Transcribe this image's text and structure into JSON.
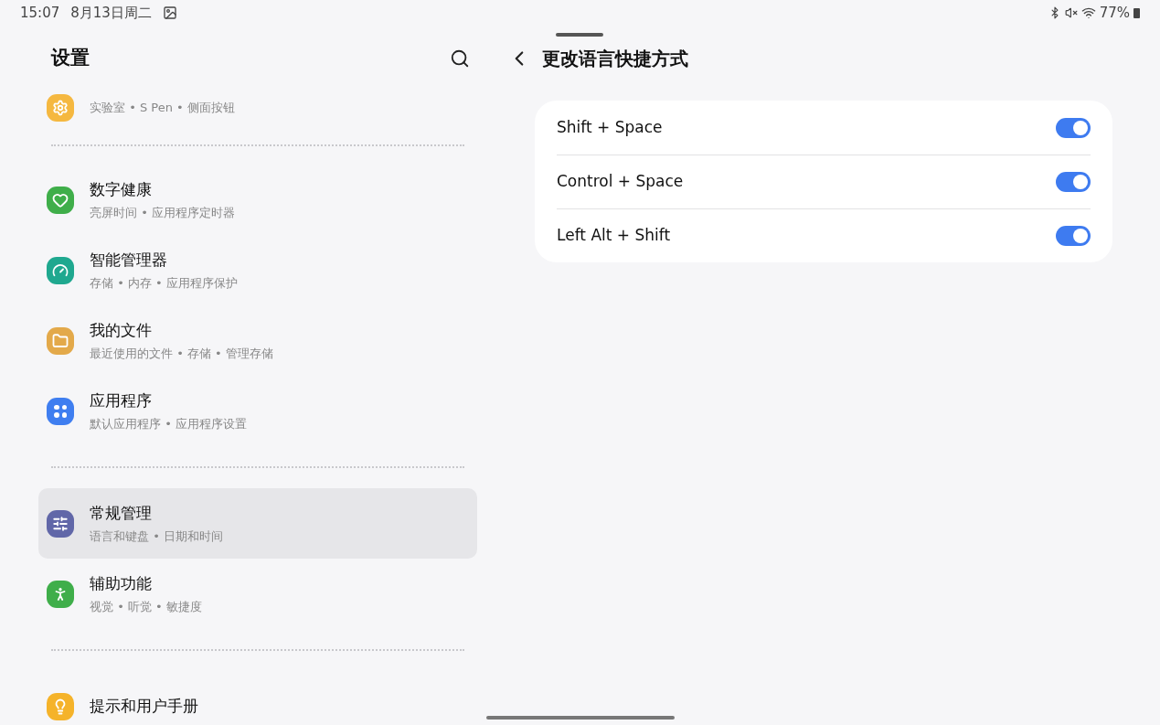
{
  "status_bar": {
    "time": "15:07",
    "date": "8月13日周二",
    "battery": "77%"
  },
  "sidebar": {
    "title": "设置",
    "sections": [
      {
        "items": [
          {
            "kind": "gear",
            "subtitle": "实验室 • S Pen • 侧面按钮",
            "color": "#f5b840",
            "selected": false
          }
        ]
      },
      {
        "items": [
          {
            "kind": "heart",
            "title": "数字健康",
            "subtitle": "亮屏时间 • 应用程序定时器",
            "color": "#3fae4a",
            "selected": false
          },
          {
            "kind": "gauge",
            "title": "智能管理器",
            "subtitle": "存储 • 内存 • 应用程序保护",
            "color": "#1fa88f",
            "selected": false
          },
          {
            "kind": "folder",
            "title": "我的文件",
            "subtitle": "最近使用的文件 • 存储 • 管理存储",
            "color": "#e3a94a",
            "selected": false
          },
          {
            "kind": "apps",
            "title": "应用程序",
            "subtitle": "默认应用程序 • 应用程序设置",
            "color": "#3f7ef0",
            "selected": false
          }
        ]
      },
      {
        "items": [
          {
            "kind": "sliders",
            "title": "常规管理",
            "subtitle": "语言和键盘 • 日期和时间",
            "color": "#6167a8",
            "selected": true
          },
          {
            "kind": "person",
            "title": "辅助功能",
            "subtitle": "视觉 • 听觉 • 敏捷度",
            "color": "#3fae4a",
            "selected": false
          }
        ]
      },
      {
        "items": [
          {
            "kind": "bulb",
            "title": "提示和用户手册",
            "color": "#f5b32a",
            "selected": false
          }
        ]
      }
    ]
  },
  "detail": {
    "title": "更改语言快捷方式",
    "shortcuts": [
      {
        "label": "Shift + Space",
        "on": true
      },
      {
        "label": "Control + Space",
        "on": true
      },
      {
        "label": "Left Alt + Shift",
        "on": true
      }
    ]
  }
}
